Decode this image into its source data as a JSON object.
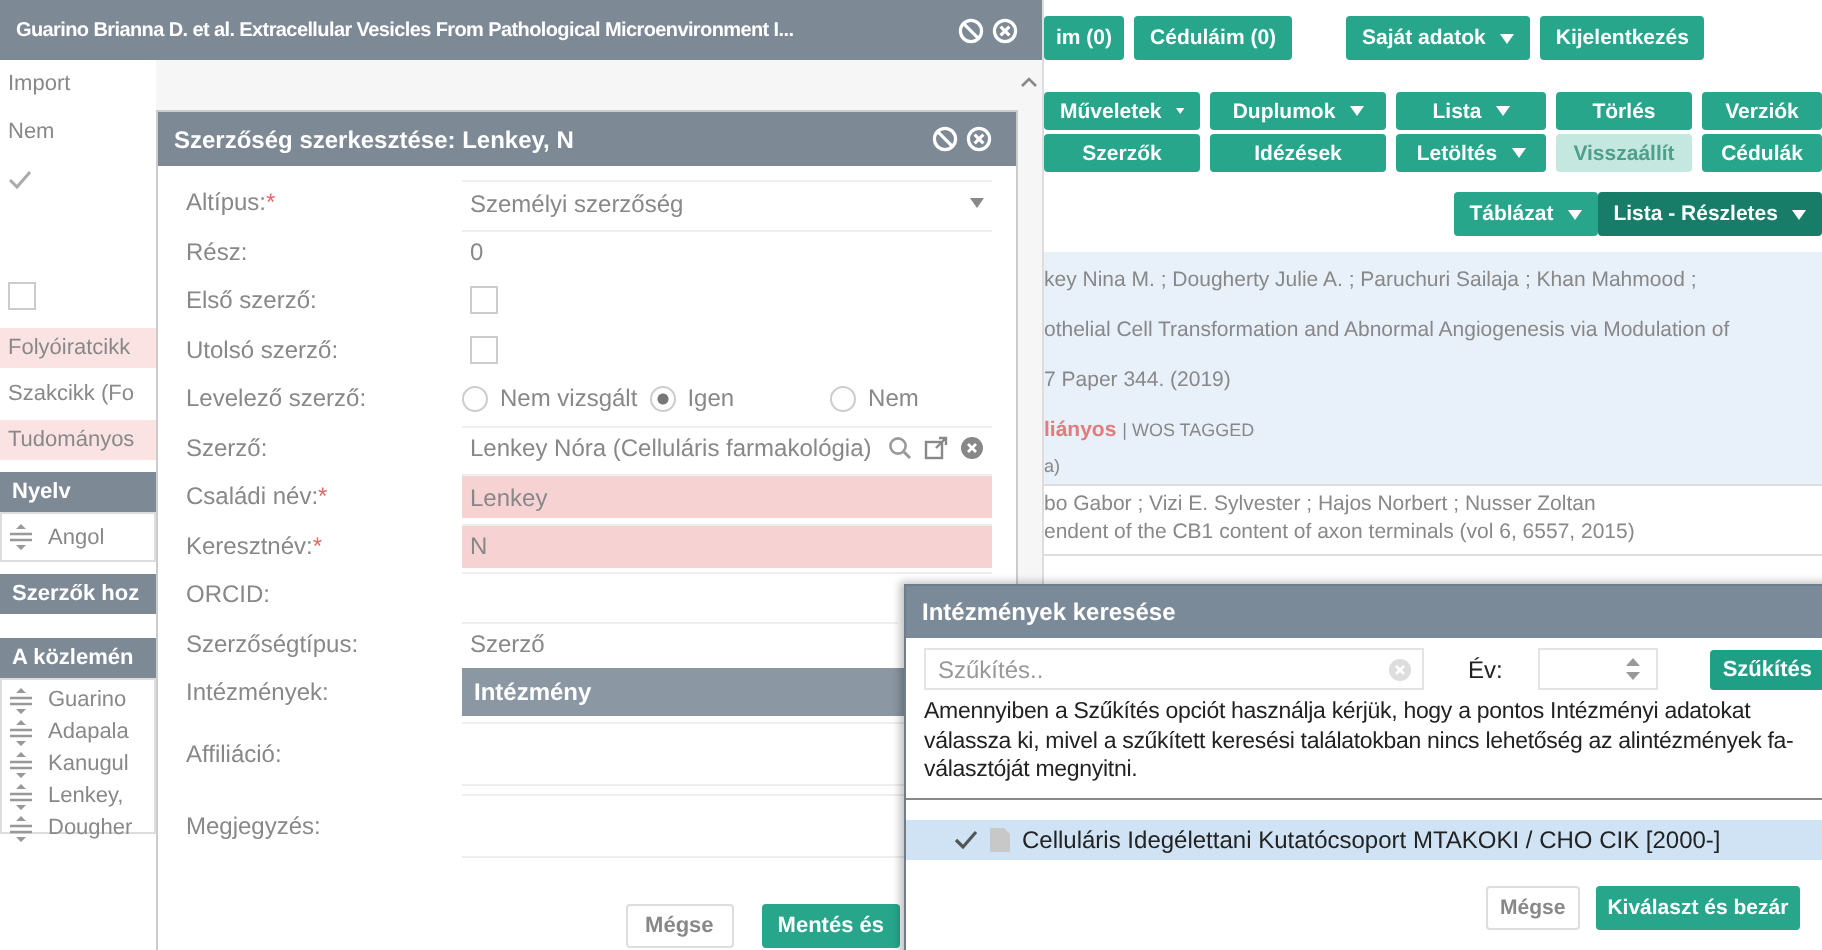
{
  "record_window": {
    "title": "Guarino Brianna D. et al. Extracellular Vesicles From Pathological Microenvironment I...",
    "fields": [
      {
        "kind": "text",
        "text": "Import"
      },
      {
        "kind": "text",
        "text": "Nem"
      },
      {
        "kind": "check",
        "checked": true
      },
      {
        "kind": "checkbox",
        "checked": false
      }
    ],
    "types": [
      {
        "text": "Folyóiratcikk",
        "invalid": true
      },
      {
        "text": "Szakcikk (Fo",
        "invalid": false
      },
      {
        "text": "Tudományos",
        "invalid": true
      }
    ],
    "language": {
      "title": "Nyelv",
      "items": [
        "Angol"
      ]
    },
    "add_authors": {
      "title": "Szerzők hoz"
    },
    "authors": {
      "title": "A közlemén",
      "items": [
        "Guarino",
        "Adapala",
        "Kanugul",
        "Lenkey,",
        "Dougher"
      ]
    }
  },
  "page": {
    "top_buttons": [
      {
        "label": "im (0)",
        "dropdown": false
      },
      {
        "label": "Céduláim (0)",
        "dropdown": false
      },
      {
        "label": "Saját adatok",
        "dropdown": true
      },
      {
        "label": "Kijelentkezés",
        "dropdown": false
      }
    ],
    "action_rows": [
      [
        {
          "label": "Műveletek",
          "dropdown": true,
          "disabled": false
        },
        {
          "label": "Duplumok",
          "dropdown": true,
          "disabled": false
        },
        {
          "label": "Lista",
          "dropdown": true,
          "disabled": false
        },
        {
          "label": "Törlés",
          "dropdown": false,
          "disabled": false
        },
        {
          "label": "Verziók",
          "dropdown": false,
          "disabled": false
        }
      ],
      [
        {
          "label": "Szerzők",
          "dropdown": false,
          "disabled": false
        },
        {
          "label": "Idézések",
          "dropdown": false,
          "disabled": false
        },
        {
          "label": "Letöltés",
          "dropdown": true,
          "disabled": false
        },
        {
          "label": "Visszaállít",
          "dropdown": false,
          "disabled": true
        },
        {
          "label": "Cédulák",
          "dropdown": false,
          "disabled": false
        }
      ]
    ],
    "view_buttons": [
      {
        "label": "Táblázat",
        "selected": false
      },
      {
        "label": "Lista - Részletes",
        "selected": true
      }
    ],
    "records": [
      {
        "selected": true,
        "lines": [
          "key Nina M. ;   Dougherty Julie A. ;   Paruchuri Sailaja ;   Khan Mahmood ;",
          "othelial Cell Transformation and Abnormal Angiogenesis via Modulation of",
          "7 Paper 344. (2019)"
        ],
        "status": {
          "flag": "liányos",
          "tags": "| WOS TAGGED"
        },
        "note": "a)"
      },
      {
        "selected": false,
        "lines": [
          "bo Gabor ;   Vizi E. Sylvester ;   Hajos Norbert ;   Nusser Zoltan",
          "endent of the CB1 content of axon terminals (vol 6, 6557, 2015)"
        ]
      }
    ]
  },
  "editor": {
    "title": "Szerzőség szerkesztése: Lenkey, N",
    "rows": [
      {
        "label": "Altípus:",
        "mark": "*",
        "kind": "select",
        "value": "Személyi szerzőség"
      },
      {
        "label": "Rész:",
        "kind": "input",
        "value": "0"
      },
      {
        "label": "Első szerző:",
        "kind": "checkbox",
        "checked": false
      },
      {
        "label": "Utolsó szerző:",
        "kind": "checkbox",
        "checked": false
      },
      {
        "label": "Levelező szerző:",
        "kind": "radio",
        "options": [
          {
            "label": "Nem vizsgált",
            "selected": false
          },
          {
            "label": "Igen",
            "selected": true
          },
          {
            "label": "Nem",
            "selected": false
          }
        ]
      },
      {
        "label": "Szerző:",
        "kind": "lookup",
        "value": "Lenkey Nóra (Celluláris farmakológia)"
      },
      {
        "label": "Családi név:",
        "mark": "*",
        "kind": "input",
        "value": "Lenkey",
        "invalid": true
      },
      {
        "label": "Keresztnév:",
        "mark": "*",
        "kind": "input",
        "value": "N",
        "invalid": true
      },
      {
        "label": "ORCID:",
        "kind": "input"
      },
      {
        "label": "Szerzőségtípus:",
        "kind": "search",
        "value": "Szerző"
      },
      {
        "label": "Intézmények:",
        "kind": "table",
        "header": "Intézmény"
      },
      {
        "label": "Affiliáció:",
        "kind": "textarea"
      },
      {
        "label": "Megjegyzés:",
        "kind": "textarea"
      }
    ],
    "buttons": [
      {
        "label": "Mégse",
        "kind": "secondary"
      },
      {
        "label": "Mentés és",
        "kind": "primary"
      }
    ]
  },
  "institution_search": {
    "title": "Intézmények keresése",
    "filter": {
      "placeholder": "Szűkítés.."
    },
    "year_label": "Év:",
    "filter_button": "Szűkítés",
    "notice": "Amennyiben a Szűkítés opciót használja kérjük, hogy a pontos Intézményi adatokat válassza ki, mivel a szűkített keresési találatokban nincs lehetőség az alintézmények fa-választóját megnyitni.",
    "tree": [
      {
        "label": "Celluláris Idegélettani Kutatócsoport MTAKOKI / CHO CIK [2000-]",
        "checked": true,
        "selected": true
      }
    ],
    "buttons": [
      {
        "label": "Mégse",
        "kind": "secondary"
      },
      {
        "label": "Kiválaszt és bezár",
        "kind": "primary"
      }
    ]
  }
}
